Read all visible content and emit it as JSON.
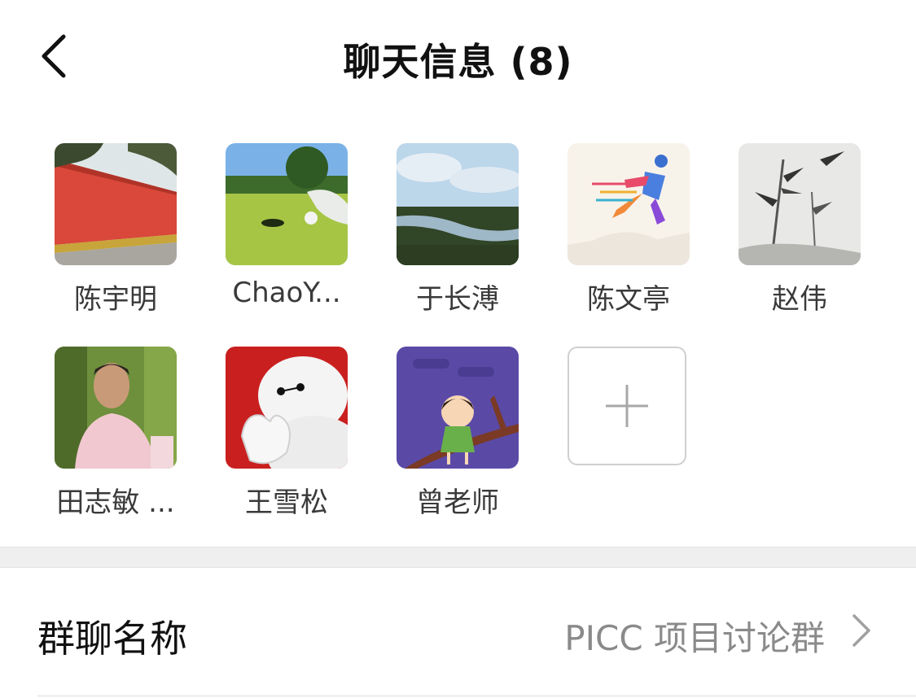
{
  "header": {
    "title": "聊天信息 (8)",
    "back_icon": "chevron-left-icon"
  },
  "members": [
    {
      "name": "陈宇明",
      "avatar": "red-wall-photo"
    },
    {
      "name": "ChaoY...",
      "avatar": "golf-course-photo"
    },
    {
      "name": "于长溥",
      "avatar": "river-landscape-photo"
    },
    {
      "name": "陈文亭",
      "avatar": "runner-illustration"
    },
    {
      "name": "赵伟",
      "avatar": "bamboo-ink-painting"
    },
    {
      "name": "田志敏 ...",
      "avatar": "man-portrait-photo"
    },
    {
      "name": "王雪松",
      "avatar": "baymax-illustration"
    },
    {
      "name": "曾老师",
      "avatar": "girl-cartoon-illustration"
    }
  ],
  "add_member": {
    "icon": "plus-icon"
  },
  "group_name_row": {
    "label": "群聊名称",
    "value": "PICC 项目讨论群",
    "chevron_icon": "chevron-right-icon"
  },
  "colors": {
    "title": "#111111",
    "member_name": "#3a3a3a",
    "secondary_text": "#8a8a8a",
    "separator": "#efefef"
  }
}
